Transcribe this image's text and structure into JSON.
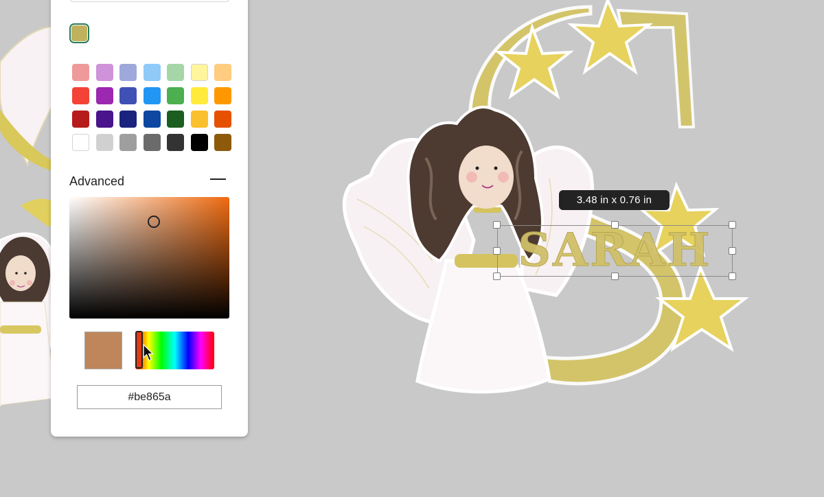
{
  "color_picker": {
    "current_color": "#bfb15e",
    "swatches": [
      {
        "name": "swatch-light-red",
        "color": "#ef9a9a"
      },
      {
        "name": "swatch-light-purple",
        "color": "#ce93d8"
      },
      {
        "name": "swatch-light-indigo",
        "color": "#9fa8da"
      },
      {
        "name": "swatch-light-blue",
        "color": "#90caf9"
      },
      {
        "name": "swatch-light-green",
        "color": "#a5d6a7"
      },
      {
        "name": "swatch-light-yellow",
        "color": "#fff59d"
      },
      {
        "name": "swatch-light-orange",
        "color": "#ffcc80"
      },
      {
        "name": "swatch-red",
        "color": "#f44336"
      },
      {
        "name": "swatch-purple",
        "color": "#9c27b0"
      },
      {
        "name": "swatch-indigo",
        "color": "#3f51b5"
      },
      {
        "name": "swatch-blue",
        "color": "#2196f3"
      },
      {
        "name": "swatch-green",
        "color": "#4caf50"
      },
      {
        "name": "swatch-yellow",
        "color": "#ffeb3b"
      },
      {
        "name": "swatch-orange",
        "color": "#ff9800"
      },
      {
        "name": "swatch-dark-red",
        "color": "#b71c1c"
      },
      {
        "name": "swatch-dark-purple",
        "color": "#4a148c"
      },
      {
        "name": "swatch-dark-indigo",
        "color": "#1a237e"
      },
      {
        "name": "swatch-dark-blue",
        "color": "#0d47a1"
      },
      {
        "name": "swatch-dark-green",
        "color": "#1b5e20"
      },
      {
        "name": "swatch-amber",
        "color": "#fbc02d"
      },
      {
        "name": "swatch-dark-orange",
        "color": "#e65100"
      },
      {
        "name": "swatch-white",
        "color": "#ffffff"
      },
      {
        "name": "swatch-light-gray",
        "color": "#d0d0d0"
      },
      {
        "name": "swatch-gray",
        "color": "#9e9e9e"
      },
      {
        "name": "swatch-dark-gray",
        "color": "#6b6b6b"
      },
      {
        "name": "swatch-charcoal",
        "color": "#333333"
      },
      {
        "name": "swatch-black",
        "color": "#000000"
      },
      {
        "name": "swatch-brown",
        "color": "#8d5a0c"
      }
    ],
    "advanced_label": "Advanced",
    "sv_hue_color": "#ee6a10",
    "preview_color": "#be865a",
    "hex_value": "#be865a"
  },
  "canvas": {
    "dimension_tooltip": "3.48  in x 0.76  in",
    "text_object": "SARAH",
    "background_color": "#c9c9c9"
  }
}
